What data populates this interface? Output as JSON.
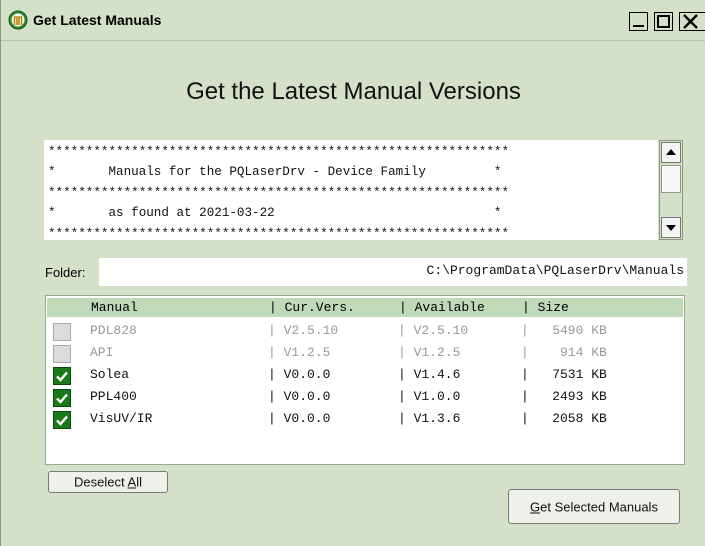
{
  "window": {
    "title": "Get Latest Manuals",
    "heading": "Get the Latest Manual Versions"
  },
  "info_text": {
    "lines": [
      "*************************************************************",
      "*       Manuals for the PQLaserDrv - Device Family         *",
      "*************************************************************",
      "*       as found at 2021-03-22                             *",
      "*************************************************************"
    ]
  },
  "folder": {
    "label": "Folder:",
    "value": "C:\\ProgramData\\PQLaserDrv\\Manuals"
  },
  "list": {
    "header": {
      "manual": "Manual",
      "cur_vers": "| Cur.Vers.",
      "available": "| Available",
      "size": "| Size"
    },
    "rows": [
      {
        "manual": "PDL828",
        "cur_vers": "| V2.5.10",
        "available": "| V2.5.10",
        "size": "|   5490 KB",
        "checked": false,
        "enabled": false
      },
      {
        "manual": "API",
        "cur_vers": "| V1.2.5",
        "available": "| V1.2.5",
        "size": "|    914 KB",
        "checked": false,
        "enabled": false
      },
      {
        "manual": "Solea",
        "cur_vers": "| V0.0.0",
        "available": "| V1.4.6",
        "size": "|   7531 KB",
        "checked": true,
        "enabled": true
      },
      {
        "manual": "PPL400",
        "cur_vers": "| V0.0.0",
        "available": "| V1.0.0",
        "size": "|   2493 KB",
        "checked": true,
        "enabled": true
      },
      {
        "manual": "VisUV/IR",
        "cur_vers": "| V0.0.0",
        "available": "| V1.3.6",
        "size": "|   2058 KB",
        "checked": true,
        "enabled": true
      }
    ]
  },
  "buttons": {
    "deselect_all_pre": "Deselect ",
    "deselect_all_key": "A",
    "deselect_all_post": "ll",
    "get_selected_key": "G",
    "get_selected_post": "et Selected Manuals"
  },
  "colors": {
    "window_bg": "#d4e0c8",
    "list_header_bg": "#bfd9b9",
    "checkbox_on": "#1a7a1a",
    "disabled_text": "#9a9a9a"
  }
}
